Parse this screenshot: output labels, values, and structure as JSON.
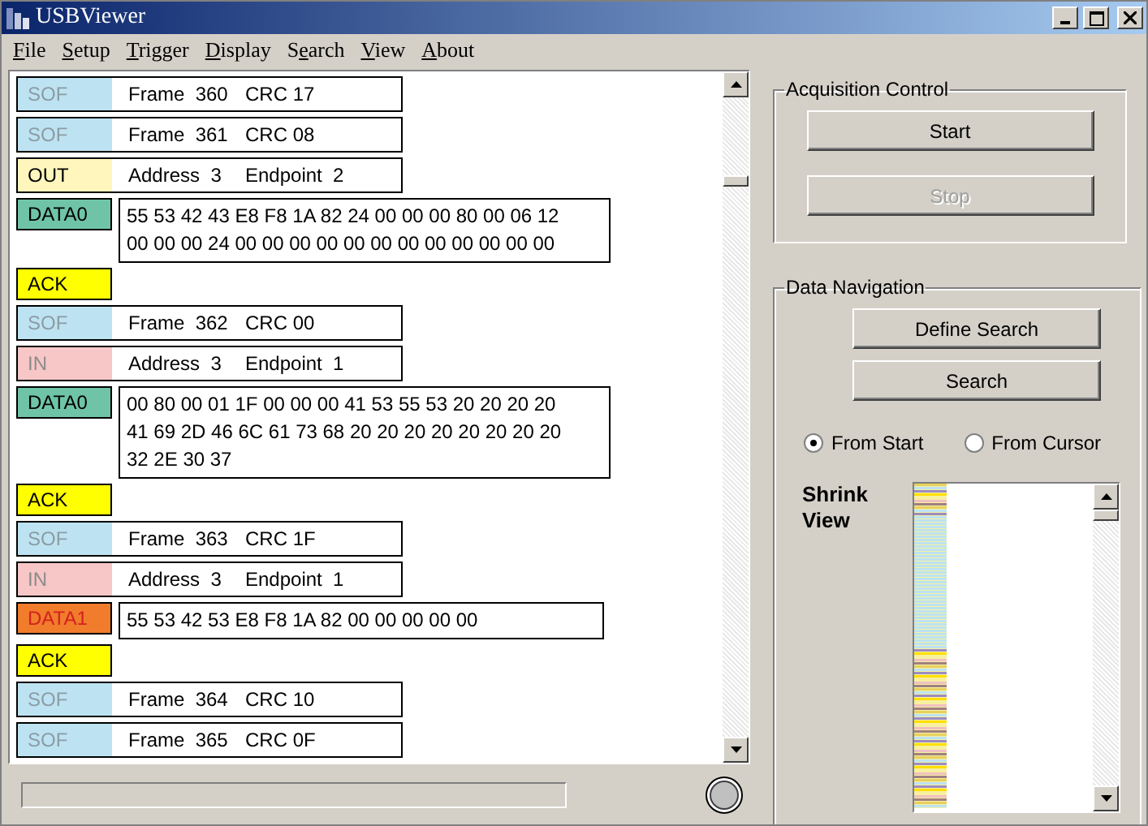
{
  "window": {
    "title": "USBViewer"
  },
  "menu": [
    {
      "label": "File"
    },
    {
      "label": "Setup"
    },
    {
      "label": "Trigger"
    },
    {
      "label": "Display"
    },
    {
      "label": "Search"
    },
    {
      "label": "View"
    },
    {
      "label": "About"
    }
  ],
  "packets": [
    {
      "kind": "token",
      "pid": "SOF",
      "color": "#bde3f2",
      "fields": [
        "Frame  360",
        "CRC 17"
      ]
    },
    {
      "kind": "token",
      "pid": "SOF",
      "color": "#bde3f2",
      "fields": [
        "Frame  361",
        "CRC 08"
      ]
    },
    {
      "kind": "token",
      "pid": "OUT",
      "color": "#fff6bd",
      "fields": [
        "Address  3",
        "Endpoint  2"
      ]
    },
    {
      "kind": "data",
      "pid": "DATA0",
      "color": "#6fc4a8",
      "lines": [
        "55 53 42 43 E8 F8 1A 82 24 00 00 00 80 00 06 12",
        "00 00 00 24 00 00 00 00 00 00 00 00 00 00 00 00"
      ]
    },
    {
      "kind": "handshake",
      "pid": "ACK",
      "color": "#ffff00"
    },
    {
      "kind": "token",
      "pid": "SOF",
      "color": "#bde3f2",
      "fields": [
        "Frame  362",
        "CRC 00"
      ]
    },
    {
      "kind": "token",
      "pid": "IN",
      "color": "#f7c6c6",
      "fields": [
        "Address  3",
        "Endpoint  1"
      ]
    },
    {
      "kind": "data",
      "pid": "DATA0",
      "color": "#6fc4a8",
      "lines": [
        "00 80 00 01 1F 00 00 00 41 53 55 53 20 20 20 20",
        "41 69 2D 46 6C 61 73 68 20 20 20 20 20 20 20 20",
        "32 2E 30 37"
      ]
    },
    {
      "kind": "handshake",
      "pid": "ACK",
      "color": "#ffff00"
    },
    {
      "kind": "token",
      "pid": "SOF",
      "color": "#bde3f2",
      "fields": [
        "Frame  363",
        "CRC 1F"
      ]
    },
    {
      "kind": "token",
      "pid": "IN",
      "color": "#f7c6c6",
      "fields": [
        "Address  3",
        "Endpoint  1"
      ]
    },
    {
      "kind": "data",
      "pid": "DATA1",
      "color": "#f07c2c",
      "lines": [
        "55 53 42 53 E8 F8 1A 82 00 00 00 00 00"
      ]
    },
    {
      "kind": "handshake",
      "pid": "ACK",
      "color": "#ffff00"
    },
    {
      "kind": "token",
      "pid": "SOF",
      "color": "#bde3f2",
      "fields": [
        "Frame  364",
        "CRC 10"
      ]
    },
    {
      "kind": "token",
      "pid": "SOF",
      "color": "#bde3f2",
      "fields": [
        "Frame  365",
        "CRC 0F"
      ]
    }
  ],
  "acquisition": {
    "title": "Acquisition Control",
    "buttons": [
      {
        "label": "Start",
        "disabled": false
      },
      {
        "label": "Stop",
        "disabled": true
      }
    ]
  },
  "navigation": {
    "title": "Data Navigation",
    "buttons": [
      {
        "label": "Define Search",
        "disabled": false
      },
      {
        "label": "Search",
        "disabled": false
      }
    ],
    "radios": [
      {
        "label": "From Start",
        "selected": true
      },
      {
        "label": "From Cursor",
        "selected": false
      }
    ],
    "shrink_view": {
      "label": "Shrink View"
    }
  }
}
